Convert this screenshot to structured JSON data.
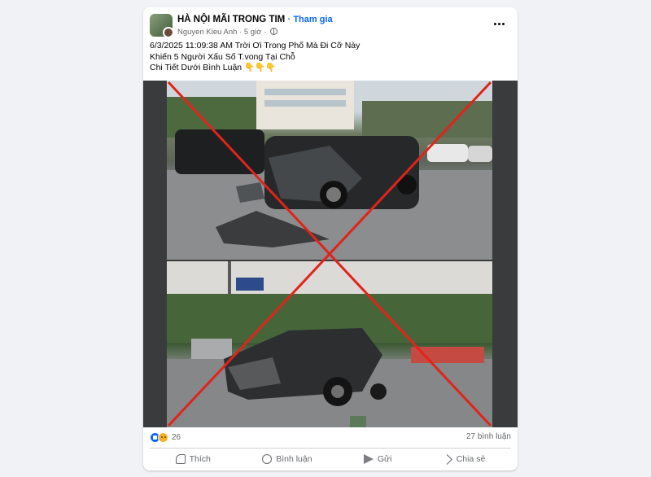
{
  "post": {
    "group_name": "HÀ NỘI MÃI TRONG TIM",
    "separator": "·",
    "join_label": "Tham gia",
    "author": "Nguyen Kieu Anh",
    "time": "5 giờ",
    "time_separator": "·",
    "text_lines": [
      "6/3/2025 11:09:38 AM Trời Ơi Trong Phố Mà Đi Cỡ Này",
      "Khiến 5 Người Xấu Số T.vong Tại Chỗ",
      "Chi Tiết Dưới Bình Luận 👇👇👇"
    ]
  },
  "stats": {
    "reaction_count": "26",
    "comment_count": "27 bình luận"
  },
  "actions": {
    "like": "Thích",
    "comment": "Bình luận",
    "send": "Gửi",
    "share": "Chia sẻ"
  },
  "colors": {
    "accent": "#0866ff",
    "cross": "#e0241b",
    "secondary_text": "#65676b"
  },
  "icons": [
    "group-avatar",
    "globe-icon",
    "more-options-icon",
    "like-reaction-icon",
    "sad-reaction-icon",
    "thumbs-up-icon",
    "comment-icon",
    "send-icon",
    "share-icon"
  ]
}
